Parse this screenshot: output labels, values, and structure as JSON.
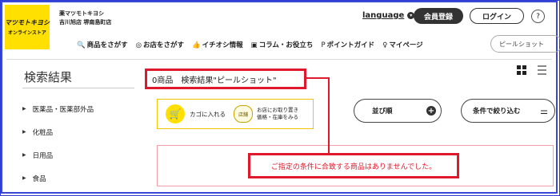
{
  "header": {
    "logo_line1": "マツモトキヨシ",
    "logo_line2": "オンラインストア",
    "store_line1": "薬マツモトキヨシ",
    "store_line2": "吉川旭店 堺南島町店",
    "language_label": "language",
    "register_label": "会員登録",
    "login_label": "ログイン",
    "help_label": "?"
  },
  "nav": {
    "items": [
      {
        "icon": "🔍",
        "label": "商品をさがす"
      },
      {
        "icon": "◎",
        "label": "お店をさがす"
      },
      {
        "icon": "👍",
        "label": "イチオシ情報"
      },
      {
        "icon": "▣",
        "label": "コラム・お役立ち"
      },
      {
        "icon": "P",
        "label": "ポイントガイド"
      },
      {
        "icon": "♀",
        "label": "マイページ"
      }
    ],
    "search_value": "ピールショット"
  },
  "results": {
    "title": "検索結果",
    "summary": "0商品　検索結果\"ピールショット\"",
    "empty_message": "ご指定の条件に合致する商品はありませんでした。"
  },
  "categories": [
    "医薬品・医薬部外品",
    "化粧品",
    "日用品",
    "食品"
  ],
  "legend": {
    "cart_label": "カゴに入れる",
    "pickup_line1": "お店にお取り置き",
    "pickup_line2": "価格・在庫をみる",
    "pickup_icon_text": "店舗"
  },
  "controls": {
    "sort_label": "並び順",
    "filter_label": "条件で絞り込む"
  },
  "colors": {
    "brand_yellow": "#ffe000",
    "highlight_red": "#e0182b",
    "frame_blue": "#3a48d8"
  }
}
